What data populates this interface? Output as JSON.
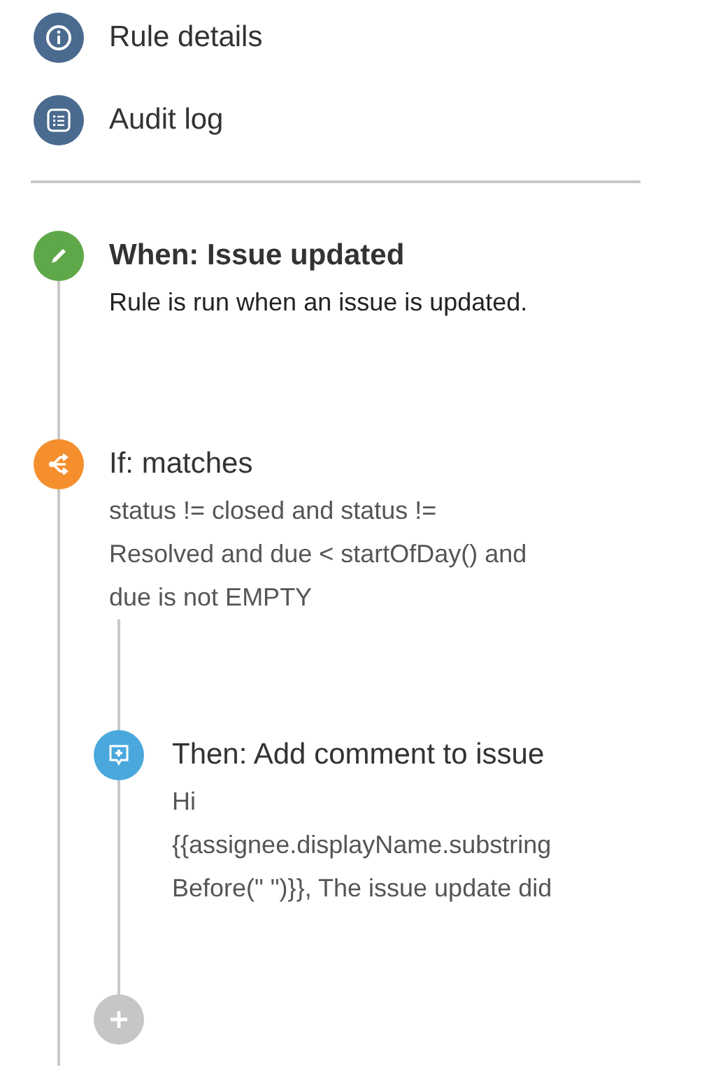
{
  "nav": [
    {
      "kind": "info",
      "label": "Rule details"
    },
    {
      "kind": "list",
      "label": "Audit log"
    }
  ],
  "steps": [
    {
      "kind": "trigger",
      "title": "When: Issue updated",
      "description": "Rule is run when an issue is updated."
    },
    {
      "kind": "condition",
      "title": "If: matches",
      "description": "status != closed and status !=\nResolved and due < startOfDay() and\ndue is not EMPTY",
      "children": [
        {
          "kind": "action",
          "title": "Then: Add comment to issue",
          "description": "Hi\n{{assignee.displayName.substring\nBefore(\" \")}}, The issue update did"
        }
      ]
    }
  ]
}
